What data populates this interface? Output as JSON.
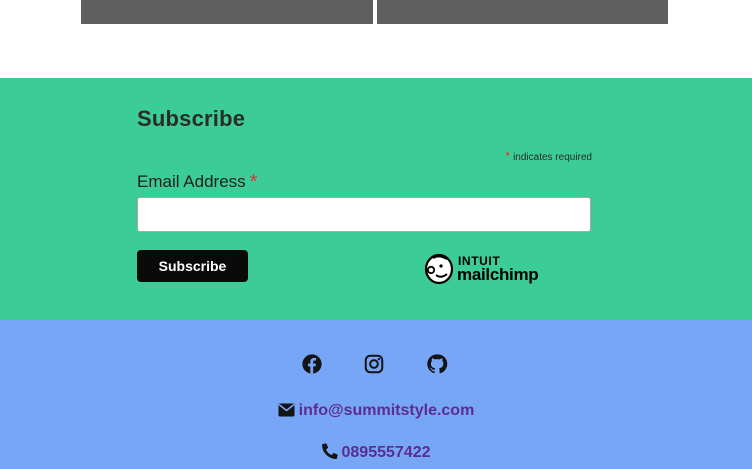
{
  "subscribe": {
    "title": "Subscribe",
    "required_asterisk": "*",
    "required_note": "indicates required",
    "email_label": "Email Address",
    "email_value": "",
    "email_placeholder": "",
    "button_label": "Subscribe",
    "badge_top": "INTUIT",
    "badge_name": "mailchimp"
  },
  "footer": {
    "social": [
      {
        "icon": "facebook-icon"
      },
      {
        "icon": "instagram-icon"
      },
      {
        "icon": "github-icon"
      }
    ],
    "email": "info@summitstyle.com",
    "phone": "0895557422"
  },
  "colors": {
    "subscribe_bg": "#3ccc97",
    "footer_bg": "#78a6f7",
    "link_color": "#5b2d90",
    "required_asterisk": "#e03131",
    "button_bg": "#0a0a0a"
  }
}
